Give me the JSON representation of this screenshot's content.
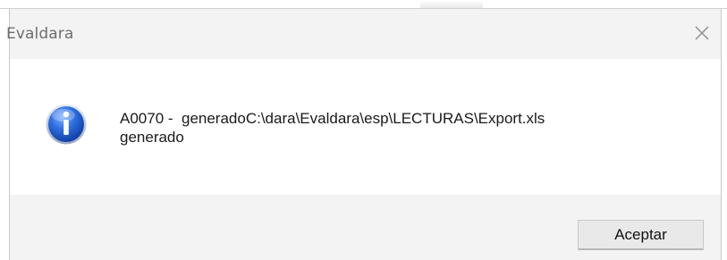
{
  "dialog": {
    "title": "Evaldara",
    "close_icon": "close-icon",
    "message_icon": "info-icon",
    "message": "A0070 -  generadoC:\\dara\\Evaldara\\esp\\LECTURAS\\Export.xls\ngenerado",
    "ok_label": "Aceptar"
  },
  "colors": {
    "titlebar_bg": "#f3f3f3",
    "footer_bg": "#f3f3f3",
    "content_bg": "#ffffff",
    "icon_blue": "#1f4fb8",
    "button_bg": "#e9e9e9"
  }
}
